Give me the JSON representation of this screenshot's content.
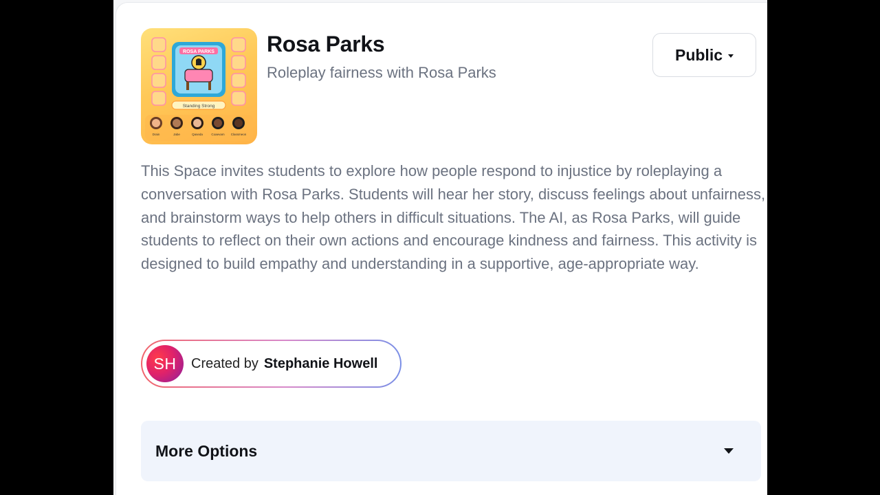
{
  "space": {
    "title": "Rosa Parks",
    "subtitle": "Roleplay fairness with Rosa Parks",
    "visibility": "Public",
    "description": "This Space invites students to explore how people respond to injustice by roleplaying a conversation with Rosa Parks. Students will hear her story, discuss feelings about unfairness, and brainstorm ways to help others in difficult situations. The AI, as Rosa Parks, will guide students to reflect on their own actions and encourage kindness and fairness. This activity is designed to build empathy and understanding in a supportive, age-appropriate way.",
    "thumbnail": {
      "banner": "ROSA PARKS",
      "footer_label": "Standing Strong",
      "people_labels": [
        "Drain",
        "Jabe",
        "Qaseda",
        "Coaevam",
        "Classmeon"
      ],
      "accent_colors": [
        "#ffc857",
        "#ff7eb6",
        "#4fc3f7"
      ]
    }
  },
  "creator": {
    "initials": "SH",
    "prefix": "Created by",
    "name": "Stephanie Howell"
  },
  "more_options": {
    "label": "More Options"
  },
  "colors": {
    "accent_gradient": [
      "#f1646b",
      "#d889c9",
      "#7a8fe6"
    ],
    "avatar": "#e0226a",
    "options_bg": "#f0f4fc"
  }
}
